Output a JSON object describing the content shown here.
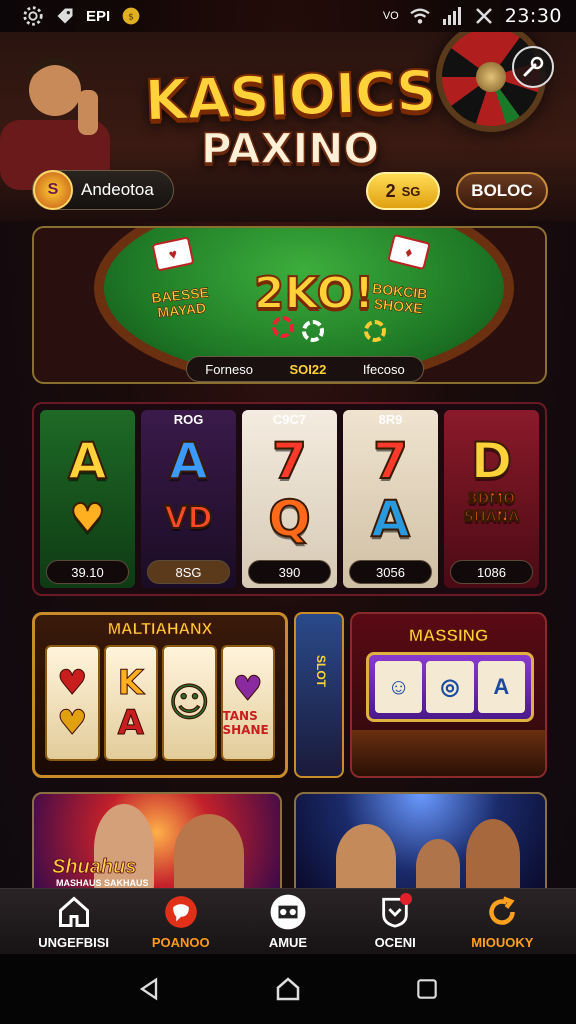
{
  "status_bar": {
    "left_label": "EPI",
    "network_label": "VO",
    "time": "23:30"
  },
  "header": {
    "title": "KASIOICS",
    "subtitle": "PAXINO",
    "user": {
      "avatar_text": "S",
      "name": "Andeotoa"
    },
    "coin_button": {
      "value": "2",
      "suffix": "SG"
    },
    "deposit_button": "BOLOC"
  },
  "banner": {
    "amount": "2KO!",
    "left_tag": "BAESSE MAYAD",
    "right_tag": "BOKCIB SHOXE",
    "info_left": "Forneso",
    "info_mid": "SOI22",
    "info_right": "Ifecoso"
  },
  "slots": [
    {
      "header": "",
      "top": "A",
      "bottom": "♥",
      "price": "39.10",
      "top_color": "#ffd23a",
      "bottom_color": "#ffb020"
    },
    {
      "header": "ROG",
      "top": "A",
      "bottom": "VD",
      "price": "8SG",
      "top_color": "#3a9aff",
      "bottom_color": "#ff4a2a"
    },
    {
      "header": "C9C7",
      "top": "7",
      "bottom": "Q",
      "price": "390",
      "top_color": "#ff3a2a",
      "bottom_color": "#ff6a1a"
    },
    {
      "header": "8R9",
      "top": "7",
      "bottom": "A",
      "price": "3056",
      "top_color": "#ff3a2a",
      "bottom_color": "#2a9adf"
    },
    {
      "header": "",
      "top": "D",
      "bottom": "3DMO SHANA",
      "price": "1086",
      "top_color": "#ffd23a",
      "bottom_color": "#ff6a1a"
    }
  ],
  "featured": {
    "slot_title": "MALTIAHANX",
    "reels": [
      {
        "top": "♥",
        "bottom": "♥"
      },
      {
        "top": "K",
        "bottom": "A"
      },
      {
        "top": "☺",
        "bottom": ""
      },
      {
        "top": "♥",
        "bottom": "TANS SHANE"
      }
    ],
    "narrow_label": "SLOT",
    "casino_title": "MASSING",
    "machine_reels": [
      "☺",
      "◎",
      "A"
    ]
  },
  "promos": {
    "left_text": "Shuahus",
    "left_subtext": "MASHAUS SAKHAUS"
  },
  "bottom_nav": [
    {
      "label": "UNGEFBISI",
      "icon": "home-icon",
      "color": "#ffffff"
    },
    {
      "label": "POANOO",
      "icon": "chat-bubble-icon",
      "color": "#ff9a1a"
    },
    {
      "label": "AMUE",
      "icon": "game-icon",
      "color": "#ffffff"
    },
    {
      "label": "OCENI",
      "icon": "shield-icon",
      "color": "#ffffff"
    },
    {
      "label": "MIOUOKY",
      "icon": "refresh-icon",
      "color": "#ffa020"
    }
  ],
  "colors": {
    "gold": "#ffd23a",
    "deposit_border": "#c98c3a",
    "active_nav": "#ff9a1a"
  }
}
